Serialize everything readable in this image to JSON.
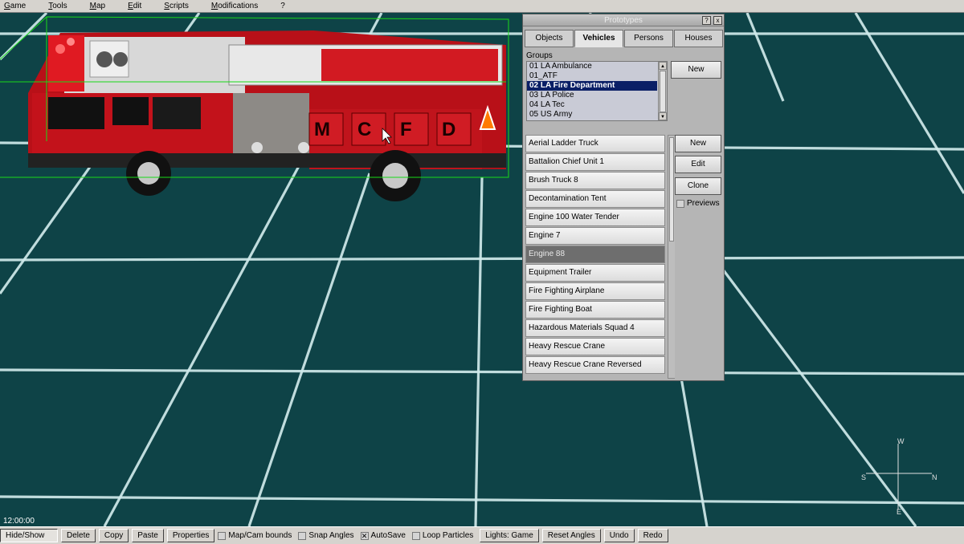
{
  "menu": [
    "Game",
    "Tools",
    "Map",
    "Edit",
    "Scripts",
    "Modifications",
    "?"
  ],
  "vehicle_lettering": [
    "M",
    "C",
    "F",
    "D"
  ],
  "dialog": {
    "title": "Prototypes",
    "help_label": "?",
    "close_label": "x",
    "tabs": [
      {
        "label": "Objects",
        "active": false
      },
      {
        "label": "Vehicles",
        "active": true
      },
      {
        "label": "Persons",
        "active": false
      },
      {
        "label": "Houses",
        "active": false
      }
    ],
    "groups_label": "Groups",
    "groups": [
      {
        "label": "01 LA Ambulance",
        "selected": false
      },
      {
        "label": "01_ATF",
        "selected": false
      },
      {
        "label": "02 LA Fire Department",
        "selected": true
      },
      {
        "label": "03 LA Police",
        "selected": false
      },
      {
        "label": "04 LA Tec",
        "selected": false
      },
      {
        "label": "05 US Army",
        "selected": false
      }
    ],
    "groups_new_label": "New",
    "vehicles": [
      {
        "label": "Aerial Ladder Truck",
        "selected": false
      },
      {
        "label": "Battalion Chief Unit 1",
        "selected": false
      },
      {
        "label": "Brush Truck 8",
        "selected": false
      },
      {
        "label": "Decontamination Tent",
        "selected": false
      },
      {
        "label": "Engine 100 Water Tender",
        "selected": false
      },
      {
        "label": "Engine 7",
        "selected": false
      },
      {
        "label": "Engine 88",
        "selected": true
      },
      {
        "label": "Equipment Trailer",
        "selected": false
      },
      {
        "label": "Fire Fighting Airplane",
        "selected": false
      },
      {
        "label": "Fire Fighting Boat",
        "selected": false
      },
      {
        "label": "Hazardous Materials Squad 4",
        "selected": false
      },
      {
        "label": "Heavy Rescue Crane",
        "selected": false
      },
      {
        "label": "Heavy Rescue Crane Reversed",
        "selected": false
      }
    ],
    "buttons": {
      "new": "New",
      "edit": "Edit",
      "clone": "Clone"
    },
    "previews_label": "Previews"
  },
  "clock": "12:00:00",
  "compass": {
    "north": "N",
    "south": "S",
    "east": "E",
    "west": "W"
  },
  "toolbar": {
    "hide_show": "Hide/Show",
    "delete": "Delete",
    "copy": "Copy",
    "paste": "Paste",
    "properties": "Properties",
    "map_cam_bounds": "Map/Cam bounds",
    "snap_angles": "Snap Angles",
    "autosave": "AutoSave",
    "loop_particles": "Loop Particles",
    "lights": "Lights: Game",
    "reset_angles": "Reset Angles",
    "undo": "Undo",
    "redo": "Redo"
  },
  "checks": {
    "map_cam_bounds": false,
    "snap_angles": false,
    "autosave": true,
    "loop_particles": false,
    "previews": false
  },
  "colors": {
    "ground": "#0e4347",
    "grid": "#cfe9ea",
    "selection_box": "#19d919",
    "truck_red": "#c0141c",
    "list_selected": "#0a1f66"
  }
}
